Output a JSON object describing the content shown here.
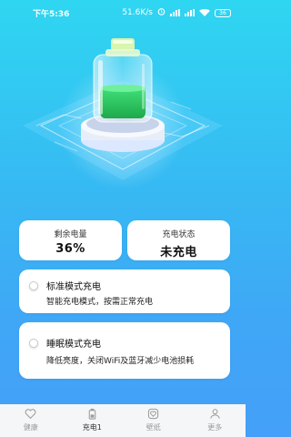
{
  "status_bar": {
    "time": "下午5:36",
    "network_speed": "51.6K/s",
    "battery": "36"
  },
  "stats": {
    "remaining_label": "剩余电量",
    "remaining_value": "36%",
    "charge_state_label": "充电状态",
    "charge_state_value": "未充电"
  },
  "modes": [
    {
      "title": "标准模式充电",
      "description": "智能充电模式，按需正常充电"
    },
    {
      "title": "睡眠模式充电",
      "description": "降低亮度，关闭WiFi及蓝牙减少电池损耗"
    }
  ],
  "nav": {
    "items": [
      {
        "label": "健康",
        "icon": "heart-icon"
      },
      {
        "label": "充电1",
        "icon": "battery-icon"
      },
      {
        "label": "壁纸",
        "icon": "heart-frame-icon"
      },
      {
        "label": "更多",
        "icon": "person-icon"
      }
    ],
    "active_index": 1
  },
  "battery_level": 0.36,
  "colors": {
    "battery_fill": "#2fc25b",
    "background_top": "#2fd6f1",
    "background_bottom": "#44a0f8"
  }
}
